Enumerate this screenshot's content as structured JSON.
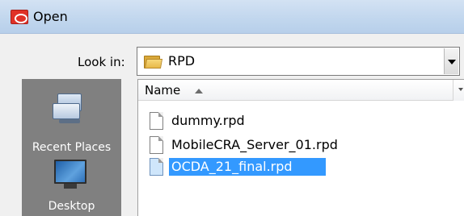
{
  "window": {
    "title": "Open",
    "app_icon": "oracle-logo-icon"
  },
  "look_in": {
    "label": "Look in:",
    "value": "RPD",
    "icon": "folder-icon"
  },
  "places": [
    {
      "label": "Recent Places",
      "icon": "recent-places-icon"
    },
    {
      "label": "Desktop",
      "icon": "desktop-icon"
    }
  ],
  "file_list": {
    "column_header": "Name",
    "sort": "ascending",
    "files": [
      {
        "name": "dummy.rpd",
        "selected": false
      },
      {
        "name": "MobileCRA_Server_01.rpd",
        "selected": false
      },
      {
        "name": "OCDA_21_final.rpd",
        "selected": true
      }
    ]
  },
  "colors": {
    "titlebar": "#c2d7ee",
    "places_bg": "#808080",
    "selection": "#3399ff"
  }
}
